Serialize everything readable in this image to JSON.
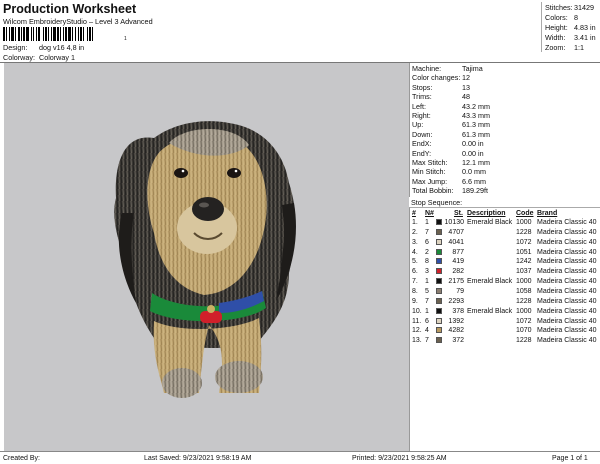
{
  "header": {
    "title": "Production Worksheet",
    "subtitle": "Wilcom EmbroideryStudio – Level 3 Advanced",
    "barcode_number": "1",
    "design_label": "Design:",
    "design_value": "dog v16 4,8 in",
    "colorway_label": "Colorway:",
    "colorway_value": "Colorway 1"
  },
  "summary": {
    "stitches_label": "Stitches:",
    "stitches": "31429",
    "colors_label": "Colors:",
    "colors": "8",
    "height_label": "Height:",
    "height": "4.83 in",
    "width_label": "Width:",
    "width": "3.41 in",
    "zoom_label": "Zoom:",
    "zoom": "1:1"
  },
  "machine": [
    {
      "k": "Machine:",
      "v": "Tajima"
    },
    {
      "k": "Color changes:",
      "v": "12"
    },
    {
      "k": "Stops:",
      "v": "13"
    },
    {
      "k": "Trims:",
      "v": "48"
    },
    {
      "k": "Left:",
      "v": "43.2 mm"
    },
    {
      "k": "Right:",
      "v": "43.3 mm"
    },
    {
      "k": "Up:",
      "v": "61.3 mm"
    },
    {
      "k": "Down:",
      "v": "61.3 mm"
    },
    {
      "k": "EndX:",
      "v": "0.00 in"
    },
    {
      "k": "EndY:",
      "v": "0.00 in"
    },
    {
      "k": "Max Stitch:",
      "v": "12.1 mm"
    },
    {
      "k": "Min Stitch:",
      "v": "0.0 mm"
    },
    {
      "k": "Max Jump:",
      "v": "6.6 mm"
    },
    {
      "k": "Total Bobbin:",
      "v": "189.29ft"
    }
  ],
  "stop_sequence": {
    "title": "Stop Sequence:",
    "headers": {
      "num": "#",
      "needle": "N#",
      "st": "St.",
      "description": "Description",
      "code": "Code",
      "brand": "Brand"
    },
    "rows": [
      {
        "num": "1.",
        "n": "1",
        "color": "#111111",
        "st": "10130",
        "desc": "Emerald Black",
        "code": "1000",
        "brand": "Madeira Classic 40"
      },
      {
        "num": "2.",
        "n": "7",
        "color": "#6b6150",
        "st": "4707",
        "desc": "",
        "code": "1228",
        "brand": "Madeira Classic 40"
      },
      {
        "num": "3.",
        "n": "6",
        "color": "#ddd3c0",
        "st": "4041",
        "desc": "",
        "code": "1072",
        "brand": "Madeira Classic 40"
      },
      {
        "num": "4.",
        "n": "2",
        "color": "#1a8a3a",
        "st": "877",
        "desc": "",
        "code": "1051",
        "brand": "Madeira Classic 40"
      },
      {
        "num": "5.",
        "n": "8",
        "color": "#2f4fa8",
        "st": "419",
        "desc": "",
        "code": "1242",
        "brand": "Madeira Classic 40"
      },
      {
        "num": "6.",
        "n": "3",
        "color": "#d0202a",
        "st": "282",
        "desc": "",
        "code": "1037",
        "brand": "Madeira Classic 40"
      },
      {
        "num": "7.",
        "n": "1",
        "color": "#111111",
        "st": "2175",
        "desc": "Emerald Black",
        "code": "1000",
        "brand": "Madeira Classic 40"
      },
      {
        "num": "8.",
        "n": "5",
        "color": "#8a7d70",
        "st": "79",
        "desc": "",
        "code": "1058",
        "brand": "Madeira Classic 40"
      },
      {
        "num": "9.",
        "n": "7",
        "color": "#6b6150",
        "st": "2293",
        "desc": "",
        "code": "1228",
        "brand": "Madeira Classic 40"
      },
      {
        "num": "10.",
        "n": "1",
        "color": "#111111",
        "st": "378",
        "desc": "Emerald Black",
        "code": "1000",
        "brand": "Madeira Classic 40"
      },
      {
        "num": "11.",
        "n": "6",
        "color": "#ddd3c0",
        "st": "1392",
        "desc": "",
        "code": "1072",
        "brand": "Madeira Classic 40"
      },
      {
        "num": "12.",
        "n": "4",
        "color": "#b89a60",
        "st": "4282",
        "desc": "",
        "code": "1070",
        "brand": "Madeira Classic 40"
      },
      {
        "num": "13.",
        "n": "7",
        "color": "#6b6150",
        "st": "372",
        "desc": "",
        "code": "1228",
        "brand": "Madeira Classic 40"
      }
    ]
  },
  "footer": {
    "created_by": "Created By:",
    "last_saved": "Last Saved: 9/23/2021 9:58:19 AM",
    "printed": "Printed: 9/23/2021 9:58:25 AM",
    "page": "Page 1 of 1"
  },
  "colors": {
    "canvas_bg": "#c7c7c9",
    "fur_tan": "#c2a673",
    "fur_dark": "#2c2a28",
    "collar_green": "#1a8a3a",
    "collar_blue": "#2f4fa8",
    "tag_red": "#d0202a"
  }
}
